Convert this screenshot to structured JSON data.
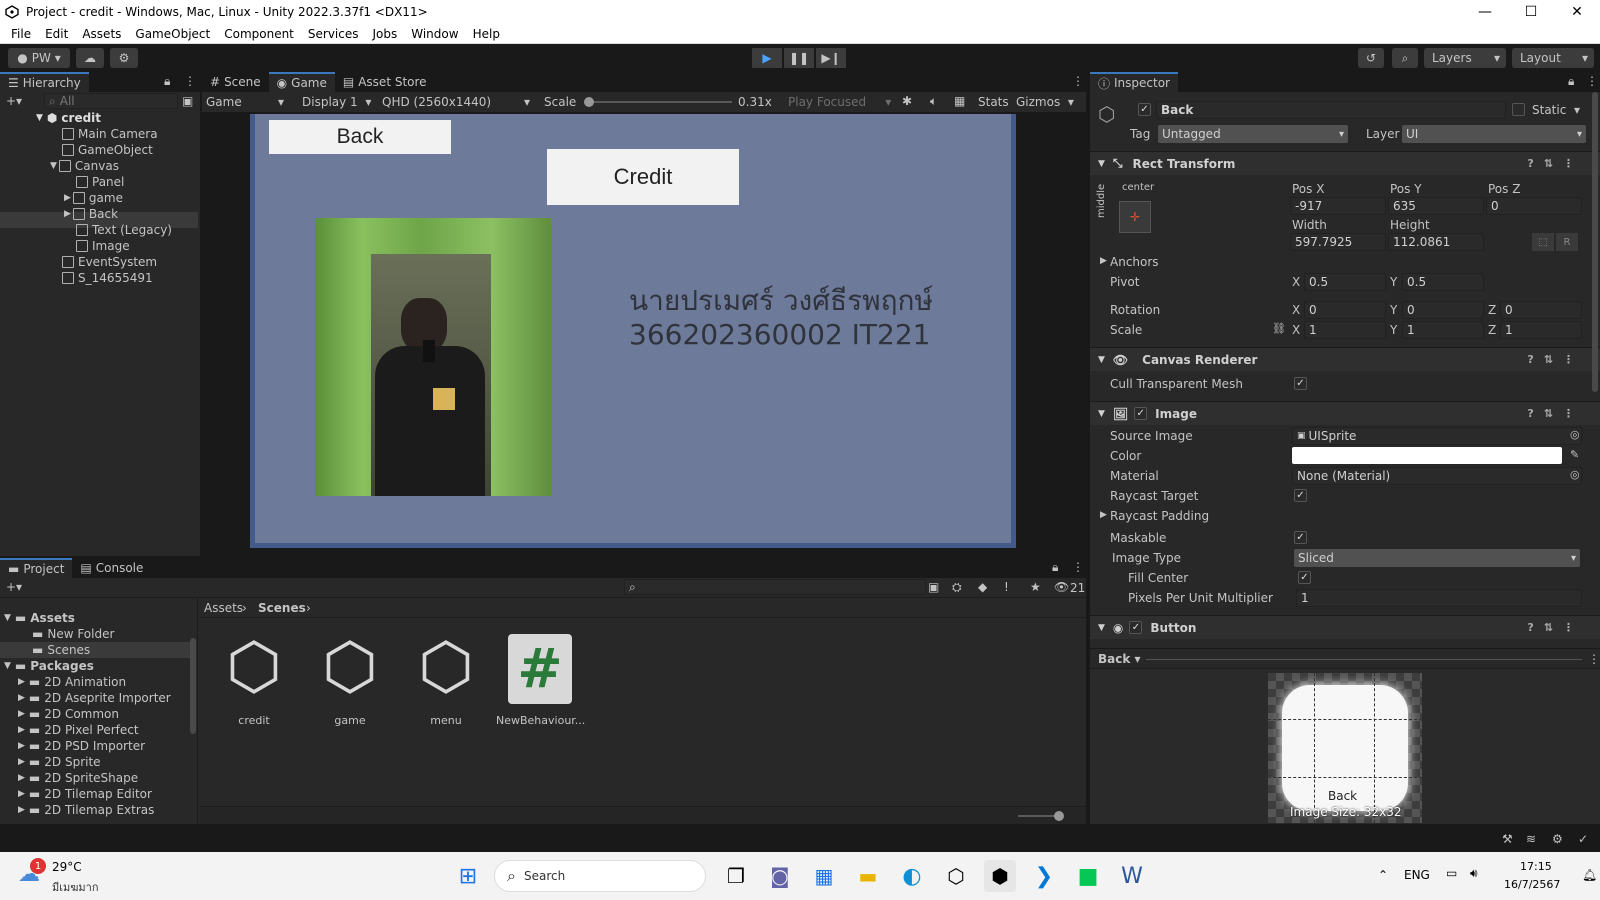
{
  "window": {
    "title": "Project - credit - Windows, Mac, Linux - Unity 2022.3.37f1 <DX11>",
    "min": "—",
    "max": "☐",
    "close": "✕"
  },
  "menu": [
    "File",
    "Edit",
    "Assets",
    "GameObject",
    "Component",
    "Services",
    "Jobs",
    "Window",
    "Help"
  ],
  "toolbar": {
    "account": "PW",
    "layers": "Layers",
    "layout": "Layout"
  },
  "hierarchy": {
    "tab": "Hierarchy",
    "search_placeholder": "All",
    "scene": "credit",
    "items": [
      "Main Camera",
      "GameObject",
      "Canvas",
      "Panel",
      "game",
      "Back",
      "Text (Legacy)",
      "Image",
      "EventSystem",
      "S_14655491"
    ]
  },
  "center_tabs": {
    "scene": "Scene",
    "game": "Game",
    "asset_store": "Asset Store"
  },
  "game_bar": {
    "mode": "Game",
    "display": "Display 1",
    "resolution": "QHD (2560x1440)",
    "scale_label": "Scale",
    "scale_value": "0.31x",
    "play_focused": "Play Focused",
    "stats": "Stats",
    "gizmos": "Gizmos",
    "scale_fraction": 0.0
  },
  "game_view": {
    "back_button": "Back",
    "credit_button": "Credit",
    "name_text": "นายปรเมศร์ วงศ์ธีรพฤกษ์",
    "id_text": "366202360002 IT221",
    "bg_color": "#6e7a99"
  },
  "inspector": {
    "tab": "Inspector",
    "object_name": "Back",
    "static_label": "Static",
    "tag_label": "Tag",
    "tag_value": "Untagged",
    "layer_label": "Layer",
    "layer_value": "UI",
    "rect_transform": {
      "title": "Rect Transform",
      "anchor_h": "center",
      "anchor_v": "middle",
      "posx_label": "Pos X",
      "posy_label": "Pos Y",
      "posz_label": "Pos Z",
      "posx": "-917",
      "posy": "635",
      "posz": "0",
      "width_label": "Width",
      "height_label": "Height",
      "width": "597.7925",
      "height": "112.0861",
      "r_button": "R",
      "anchors": "Anchors",
      "pivot": "Pivot",
      "pivot_x": "0.5",
      "pivot_y": "0.5",
      "rotation": "Rotation",
      "rot_x": "0",
      "rot_y": "0",
      "rot_z": "0",
      "scale": "Scale",
      "scale_x": "1",
      "scale_y": "1",
      "scale_z": "1",
      "x": "X",
      "y": "Y",
      "z": "Z"
    },
    "canvas_renderer": {
      "title": "Canvas Renderer",
      "cull": "Cull Transparent Mesh"
    },
    "image": {
      "title": "Image",
      "source_image": "Source Image",
      "source_value": "UISprite",
      "color": "Color",
      "material": "Material",
      "material_value": "None (Material)",
      "raycast_target": "Raycast Target",
      "raycast_padding": "Raycast Padding",
      "maskable": "Maskable",
      "image_type": "Image Type",
      "image_type_value": "Sliced",
      "fill_center": "Fill Center",
      "ppu": "Pixels Per Unit Multiplier",
      "ppu_value": "1"
    },
    "button": {
      "title": "Button"
    },
    "preview": {
      "name": "Back",
      "sprite_label": "Back",
      "size": "Image Size: 32x32"
    }
  },
  "project": {
    "tab_project": "Project",
    "tab_console": "Console",
    "hidden_count": "21",
    "breadcrumb": [
      "Assets",
      "Scenes"
    ],
    "tree": [
      {
        "label": "Assets",
        "bold": true
      },
      {
        "label": "New Folder"
      },
      {
        "label": "Scenes"
      },
      {
        "label": "Packages",
        "bold": true
      },
      {
        "label": "2D Animation"
      },
      {
        "label": "2D Aseprite Importer"
      },
      {
        "label": "2D Common"
      },
      {
        "label": "2D Pixel Perfect"
      },
      {
        "label": "2D PSD Importer"
      },
      {
        "label": "2D Sprite"
      },
      {
        "label": "2D SpriteShape"
      },
      {
        "label": "2D Tilemap Editor"
      },
      {
        "label": "2D Tilemap Extras"
      }
    ],
    "assets": [
      "credit",
      "game",
      "menu",
      "NewBehaviour..."
    ]
  },
  "taskbar": {
    "temp": "29°C",
    "weather": "มีเมฆมาก",
    "badge": "1",
    "search": "Search",
    "lang": "ENG",
    "time": "17:15",
    "date": "16/7/2567"
  }
}
